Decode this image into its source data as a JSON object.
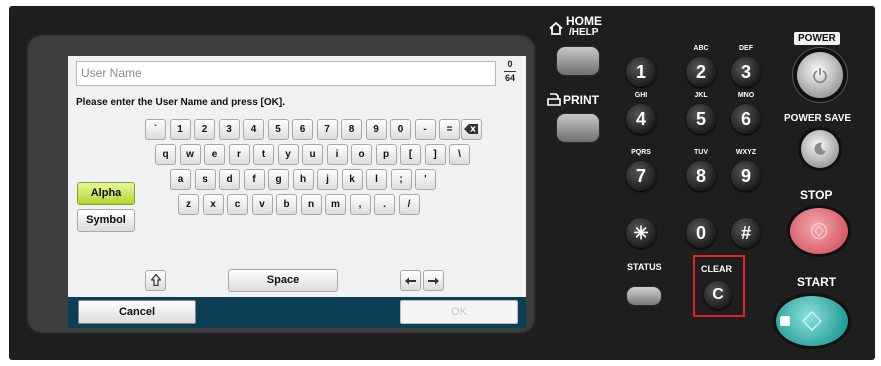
{
  "screen": {
    "input_placeholder": "User Name",
    "counter_top": "0",
    "counter_bottom": "64",
    "instruction": "Please enter the User Name and press [OK].",
    "row1": [
      "`",
      "1",
      "2",
      "3",
      "4",
      "5",
      "6",
      "7",
      "8",
      "9",
      "0",
      "-",
      "="
    ],
    "row2": [
      "q",
      "w",
      "e",
      "r",
      "t",
      "y",
      "u",
      "i",
      "o",
      "p",
      "[",
      "]",
      "\\"
    ],
    "row3": [
      "a",
      "s",
      "d",
      "f",
      "g",
      "h",
      "j",
      "k",
      "l",
      ";",
      "'"
    ],
    "row4": [
      "z",
      "x",
      "c",
      "v",
      "b",
      "n",
      "m",
      ",",
      ".",
      "/"
    ],
    "alpha_label": "Alpha",
    "symbol_label": "Symbol",
    "space_label": "Space",
    "cancel_label": "Cancel",
    "ok_label": "OK"
  },
  "hardware": {
    "home_label": "HOME",
    "help_label": "/HELP",
    "print_label": "PRINT",
    "power_label": "POWER",
    "power_save_label": "POWER SAVE",
    "stop_label": "STOP",
    "start_label": "START",
    "status_label": "STATUS",
    "clear_label": "CLEAR",
    "clear_key": "C",
    "keypad": [
      {
        "num": "1",
        "sub": ""
      },
      {
        "num": "2",
        "sub": "ABC"
      },
      {
        "num": "3",
        "sub": "DEF"
      },
      {
        "num": "4",
        "sub": "GHI"
      },
      {
        "num": "5",
        "sub": "JKL"
      },
      {
        "num": "6",
        "sub": "MNO"
      },
      {
        "num": "7",
        "sub": "PQRS"
      },
      {
        "num": "8",
        "sub": "TUV"
      },
      {
        "num": "9",
        "sub": "WXYZ"
      },
      {
        "num": "✳",
        "sub": ""
      },
      {
        "num": "0",
        "sub": ""
      },
      {
        "num": "#",
        "sub": ""
      }
    ]
  },
  "colors": {
    "clear_highlight": "#e02424",
    "alpha_active": "#b2d634",
    "stop_button": "#e0707a",
    "start_button": "#2aa5a0",
    "screen_bar": "#0c3e55"
  }
}
